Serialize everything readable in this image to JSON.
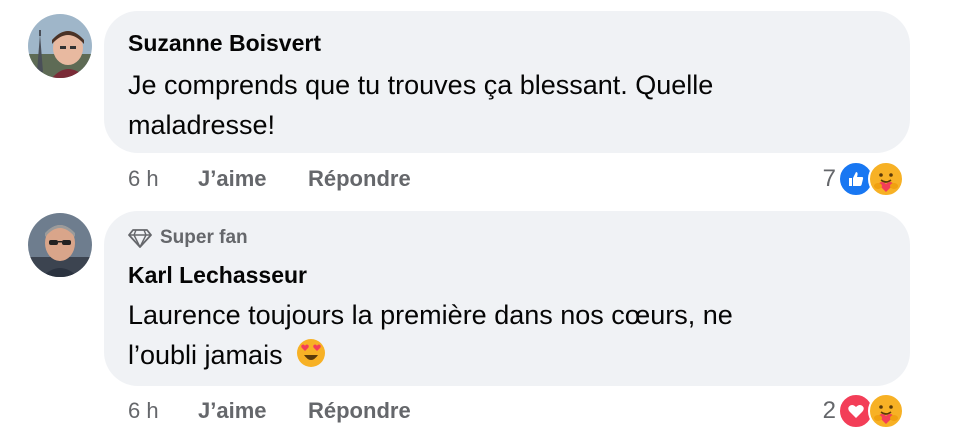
{
  "comments": [
    {
      "author": "Suzanne Boisvert",
      "text_line1": "Je comprends que tu trouves ça blessant. Quelle",
      "text_line2": "maladresse!",
      "time": "6 h",
      "like_label": "J’aime",
      "reply_label": "Répondre",
      "reaction_count": "7",
      "reactions": [
        "like-icon",
        "care-icon"
      ]
    },
    {
      "badge": "Super fan",
      "author": "Karl Lechasseur",
      "text_line1": "Laurence toujours la première dans nos cœurs, ne",
      "text_line2": "l’oubli jamais",
      "emoji": "😍",
      "time": "6 h",
      "like_label": "J’aime",
      "reply_label": "Répondre",
      "reaction_count": "2",
      "reactions": [
        "love-icon",
        "care-icon"
      ]
    }
  ],
  "colors": {
    "bubble_bg": "#f0f2f5",
    "meta_text": "#65676b",
    "like_blue": "#1877f2",
    "love_red": "#f33e58",
    "care_yellow": "#f7b125"
  }
}
